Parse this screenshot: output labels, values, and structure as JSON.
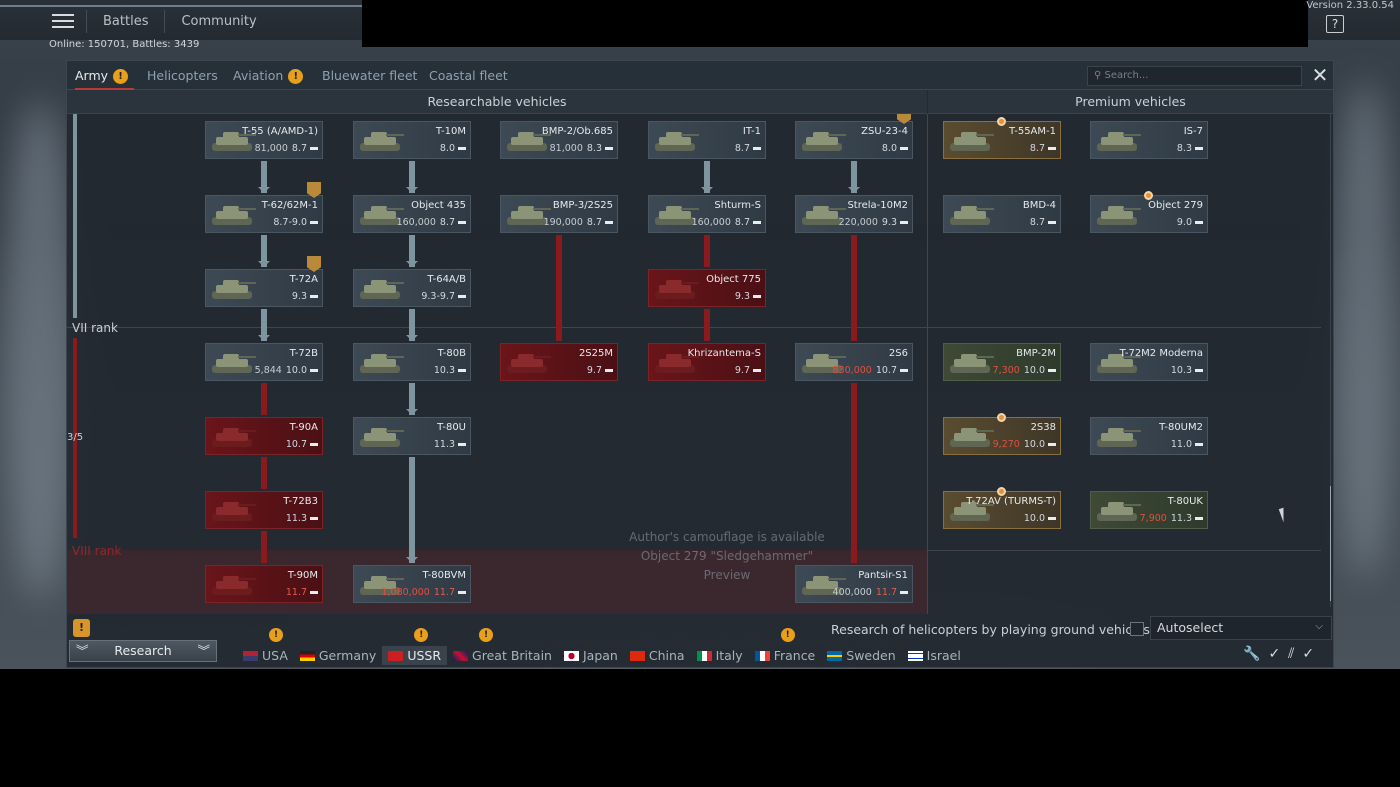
{
  "top_nav": {
    "items": [
      "Battles",
      "Community"
    ],
    "version": "Version 2.33.0.54",
    "help": "?",
    "online": "Online: 150701, Battles: 3439"
  },
  "tabs": [
    {
      "label": "Army",
      "warn": true,
      "active": true
    },
    {
      "label": "Helicopters",
      "warn": false
    },
    {
      "label": "Aviation",
      "warn": true
    },
    {
      "label": "Bluewater fleet",
      "warn": false
    },
    {
      "label": "Coastal fleet",
      "warn": false
    }
  ],
  "search": {
    "placeholder": "⚲ Search..."
  },
  "headers": {
    "researchable": "Researchable vehicles",
    "premium": "Premium vehicles"
  },
  "ranks": {
    "vii": "VII rank",
    "viii": "VIII rank",
    "progress": "3/5"
  },
  "notice": {
    "line1": "Author's camouflage is available",
    "line2": "Object 279 \"Sledgehammer\"",
    "line3": "Preview"
  },
  "vehicles": [
    {
      "name": "T-55 (A/AMD-1)",
      "price": "81,000",
      "br": "8.7",
      "style": "normal"
    },
    {
      "name": "T-10M",
      "price": "",
      "br": "8.0",
      "style": "normal"
    },
    {
      "name": "BMP-2/Ob.685",
      "price": "81,000",
      "br": "8.3",
      "style": "normal"
    },
    {
      "name": "IT-1",
      "price": "",
      "br": "8.7",
      "style": "normal"
    },
    {
      "name": "ZSU-23-4",
      "price": "",
      "br": "8.0",
      "style": "normal"
    },
    {
      "name": "T-62/62M-1",
      "price": "",
      "br": "8.7-9.0",
      "style": "normal"
    },
    {
      "name": "Object 435",
      "price": "160,000",
      "br": "8.7",
      "style": "normal"
    },
    {
      "name": "BMP-3/2S25",
      "price": "190,000",
      "br": "8.7",
      "style": "normal"
    },
    {
      "name": "Shturm-S",
      "price": "160,000",
      "br": "8.7",
      "style": "normal"
    },
    {
      "name": "Strela-10M2",
      "price": "220,000",
      "br": "9.3",
      "style": "normal"
    },
    {
      "name": "T-72A",
      "price": "",
      "br": "9.3",
      "style": "normal"
    },
    {
      "name": "T-64A/B",
      "price": "",
      "br": "9.3-9.7",
      "style": "normal"
    },
    {
      "name": "Object 775",
      "price": "",
      "br": "9.3",
      "style": "red"
    },
    {
      "name": "T-72B",
      "price": "5,844",
      "br": "10.0",
      "style": "normal"
    },
    {
      "name": "T-80B",
      "price": "",
      "br": "10.3",
      "style": "normal"
    },
    {
      "name": "2S25M",
      "price": "",
      "br": "9.7",
      "style": "red"
    },
    {
      "name": "Khrizantema-S",
      "price": "",
      "br": "9.7",
      "style": "red"
    },
    {
      "name": "2S6",
      "price": "830,000",
      "br": "10.7",
      "style": "normal",
      "price_red": true
    },
    {
      "name": "T-90A",
      "price": "",
      "br": "10.7",
      "style": "red"
    },
    {
      "name": "T-80U",
      "price": "",
      "br": "11.3",
      "style": "normal"
    },
    {
      "name": "T-72B3",
      "price": "",
      "br": "11.3",
      "style": "red"
    },
    {
      "name": "T-90M",
      "price": "",
      "br": "11.7",
      "style": "red",
      "br_red": true
    },
    {
      "name": "T-80BVM",
      "price": "1,080,000",
      "br": "11.7",
      "style": "normal",
      "price_red": true,
      "br_red": true
    },
    {
      "name": "Pantsir-S1",
      "price": "400,000",
      "br": "11.7",
      "style": "normal",
      "br_red": true
    }
  ],
  "premium": [
    {
      "name": "T-55AM-1",
      "price": "",
      "br": "8.7",
      "style": "gold"
    },
    {
      "name": "IS-7",
      "price": "",
      "br": "8.3",
      "style": "normal"
    },
    {
      "name": "BMD-4",
      "price": "",
      "br": "8.7",
      "style": "normal"
    },
    {
      "name": "Object 279",
      "price": "",
      "br": "9.0",
      "style": "normal"
    },
    {
      "name": "BMP-2M",
      "price": "7,300",
      "br": "10.0",
      "style": "green",
      "price_red": true
    },
    {
      "name": "T-72M2 Moderna",
      "price": "",
      "br": "10.3",
      "style": "normal"
    },
    {
      "name": "2S38",
      "price": "9,270",
      "br": "10.0",
      "style": "gold",
      "price_red": true
    },
    {
      "name": "T-80UM2",
      "price": "",
      "br": "11.0",
      "style": "normal"
    },
    {
      "name": "T-72AV (TURMS-T)",
      "price": "",
      "br": "10.0",
      "style": "gold"
    },
    {
      "name": "T-80UK",
      "price": "7,900",
      "br": "11.3",
      "style": "green",
      "price_red": true
    }
  ],
  "bottom": {
    "heli_option": "Research of helicopters by playing ground vehicles",
    "autoselect": "Autoselect",
    "research": "Research",
    "alert": "!"
  },
  "nations": [
    {
      "label": "USA",
      "warn": true,
      "active": false
    },
    {
      "label": "Germany",
      "warn": false,
      "active": false
    },
    {
      "label": "USSR",
      "warn": true,
      "active": true
    },
    {
      "label": "Great Britain",
      "warn": true,
      "active": false
    },
    {
      "label": "Japan",
      "warn": false,
      "active": false
    },
    {
      "label": "China",
      "warn": false,
      "active": false
    },
    {
      "label": "Italy",
      "warn": false,
      "active": false
    },
    {
      "label": "France",
      "warn": true,
      "active": false
    },
    {
      "label": "Sweden",
      "warn": false,
      "active": false
    },
    {
      "label": "Israel",
      "warn": false,
      "active": false
    }
  ],
  "colors": {
    "accent_red": "#b83a32",
    "warn": "#e8a01c",
    "locked_red": "#6a1519"
  },
  "icons": [
    "menu-icon",
    "help-icon",
    "close-icon",
    "search-icon",
    "wrench-icon",
    "check-icon",
    "double-check-icon"
  ]
}
